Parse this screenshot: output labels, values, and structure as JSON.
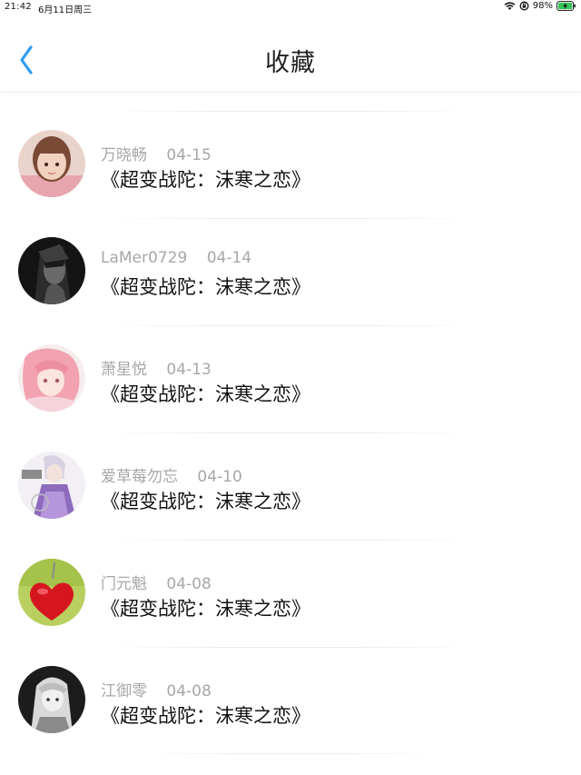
{
  "status_bar": {
    "time": "21:42",
    "date": "6月11日周三",
    "battery": "98%",
    "icons": [
      "wifi-icon",
      "orientation-lock-icon",
      "battery-charging-icon"
    ]
  },
  "nav": {
    "title": "收藏",
    "back_icon": "chevron-left-icon",
    "accent_color": "#2e9bf0"
  },
  "favorites": [
    {
      "name": "万晓畅",
      "date": "04-15",
      "title": "《超变战陀：沫寒之恋》",
      "avatar": "girl-portrait"
    },
    {
      "name": "LaMer0729",
      "date": "04-14",
      "title": "《超变战陀：沫寒之恋》",
      "avatar": "dark-anime"
    },
    {
      "name": "萧星悦",
      "date": "04-13",
      "title": "《超变战陀：沫寒之恋》",
      "avatar": "pink-hair-anime"
    },
    {
      "name": "爱草莓勿忘",
      "date": "04-10",
      "title": "《超变战陀：沫寒之恋》",
      "avatar": "purple-dress-anime"
    },
    {
      "name": "门元魁",
      "date": "04-08",
      "title": "《超变战陀：沫寒之恋》",
      "avatar": "red-heart"
    },
    {
      "name": "江御零",
      "date": "04-08",
      "title": "《超变战陀：沫寒之恋》",
      "avatar": "monochrome-anime"
    }
  ]
}
